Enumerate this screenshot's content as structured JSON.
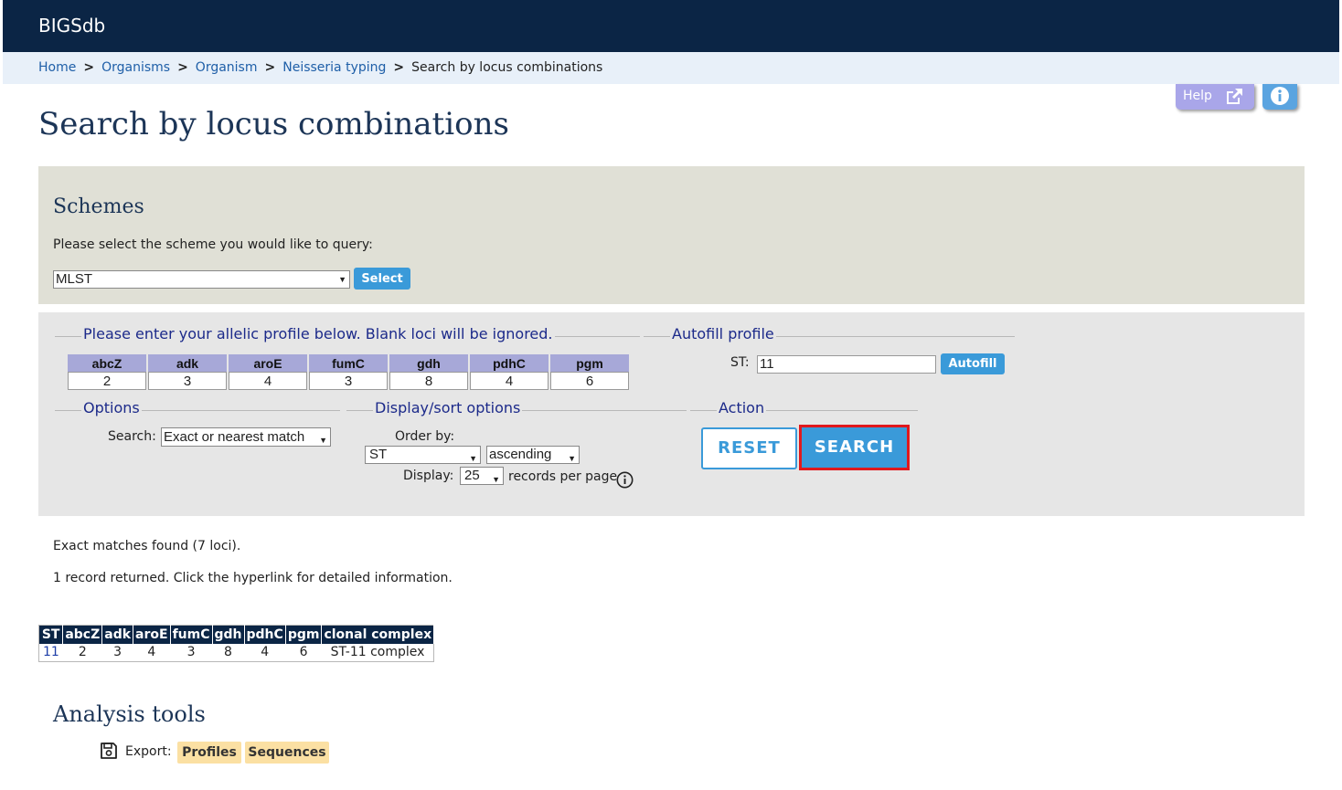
{
  "app": {
    "brand": "BIGSdb"
  },
  "breadcrumb": [
    {
      "label": "Home",
      "link": true
    },
    {
      "label": "Organisms",
      "link": true
    },
    {
      "label": "Organism",
      "link": true
    },
    {
      "label": "Neisseria typing",
      "link": true
    },
    {
      "label": "Search by locus combinations",
      "link": false
    }
  ],
  "help": {
    "label": "Help"
  },
  "page": {
    "title": "Search by locus combinations"
  },
  "schemes": {
    "title": "Schemes",
    "prompt": "Please select the scheme you would like to query:",
    "selected": "MLST",
    "select_button": "Select"
  },
  "profile": {
    "legend": "Please enter your allelic profile below. Blank loci will be ignored.",
    "loci": [
      "abcZ",
      "adk",
      "aroE",
      "fumC",
      "gdh",
      "pdhC",
      "pgm"
    ],
    "values": [
      "2",
      "3",
      "4",
      "3",
      "8",
      "4",
      "6"
    ]
  },
  "autofill": {
    "legend": "Autofill profile",
    "st_label": "ST:",
    "st_value": "11",
    "button": "Autofill"
  },
  "options": {
    "legend": "Options",
    "search_label": "Search:",
    "search_value": "Exact or nearest match"
  },
  "display_sort": {
    "legend": "Display/sort options",
    "order_label": "Order by:",
    "order_value": "ST",
    "direction_value": "ascending",
    "display_label": "Display:",
    "display_value": "25",
    "records_label": "records per page"
  },
  "action": {
    "legend": "Action",
    "reset": "RESET",
    "search": "SEARCH",
    "highlight_color": "#e0191d"
  },
  "results": {
    "message1": "Exact matches found (7 loci).",
    "message2": "1 record returned. Click the hyperlink for detailed information.",
    "headers": [
      "ST",
      "abcZ",
      "adk",
      "aroE",
      "fumC",
      "gdh",
      "pdhC",
      "pgm",
      "clonal complex"
    ],
    "rows": [
      [
        "11",
        "2",
        "3",
        "4",
        "3",
        "8",
        "4",
        "6",
        "ST-11 complex"
      ]
    ]
  },
  "analysis": {
    "title": "Analysis tools",
    "export_label": "Export:",
    "buttons": [
      "Profiles",
      "Sequences"
    ]
  },
  "colors": {
    "navbar": "#0b2545",
    "accent": "#3a9ad9",
    "scheme_panel": "#e0e0d6",
    "export_button": "#fbe0a3"
  }
}
